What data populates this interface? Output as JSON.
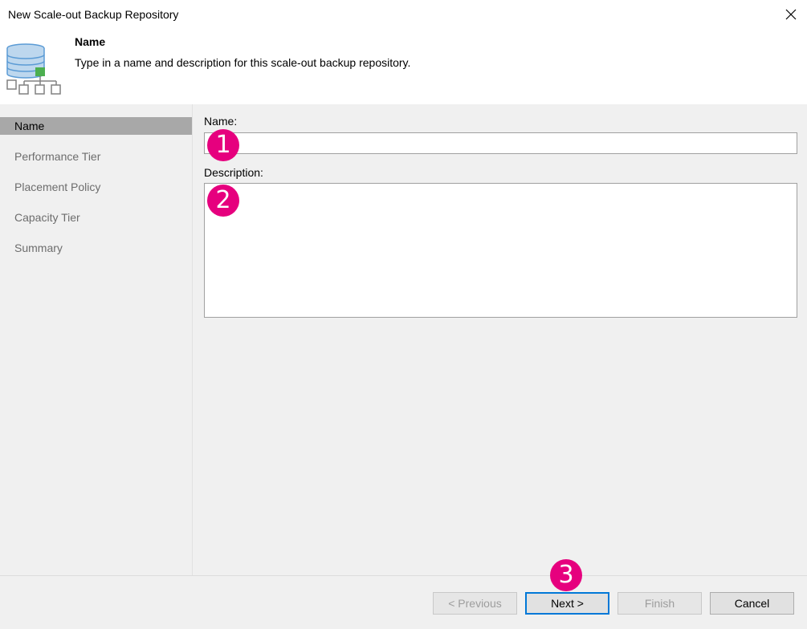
{
  "window": {
    "title": "New Scale-out Backup Repository",
    "close_glyph": "✕"
  },
  "header": {
    "title": "Name",
    "description": "Type in a name and description for this scale-out backup repository.",
    "icon": "scale-out-repository-icon"
  },
  "steps": [
    {
      "label": "Name",
      "active": true
    },
    {
      "label": "Performance Tier",
      "active": false
    },
    {
      "label": "Placement Policy",
      "active": false
    },
    {
      "label": "Capacity Tier",
      "active": false
    },
    {
      "label": "Summary",
      "active": false
    }
  ],
  "form": {
    "name_label": "Name:",
    "name_value": "",
    "description_label": "Description:",
    "description_value": ""
  },
  "markers": {
    "m1": "1",
    "m2": "2",
    "m3": "3"
  },
  "buttons": {
    "previous": "< Previous",
    "next": "Next >",
    "finish": "Finish",
    "cancel": "Cancel"
  },
  "colors": {
    "marker": "#e6007e",
    "active_step": "#a8a8a8",
    "focus_border": "#0078d7",
    "panel_bg": "#f0f0f0"
  }
}
